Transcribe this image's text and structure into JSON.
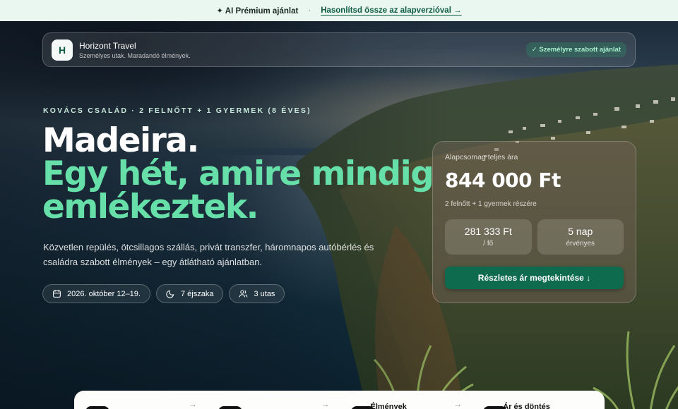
{
  "topbar": {
    "ai_label": "✦ AI Prémium ajánlat",
    "separator": "·",
    "compare_link": "Hasonlítsd össze az alapverzióval →"
  },
  "brand": {
    "logo_letter": "H",
    "name": "Horizont Travel",
    "tagline": "Személyes utak. Maradandó élmények.",
    "badge": "✓ Személyre szabott ajánlat"
  },
  "hero": {
    "eyebrow": "KOVÁCS CSALÁD · 2 FELNŐTT + 1 GYERMEK (8 ÉVES)",
    "title_line1": "Madeira.",
    "title_line2": "Egy hét, amire mindig",
    "title_line3": "emlékeztek.",
    "lead": "Közvetlen repülés, ötcsillagos szállás, privát transzfer, háromnapos autóbérlés és családra szabott élmények – egy átlátható ajánlatban.",
    "chips": [
      {
        "icon": "calendar-icon",
        "label": "2026. október 12–19."
      },
      {
        "icon": "moon-icon",
        "label": "7 éjszaka"
      },
      {
        "icon": "users-icon",
        "label": "3 utas"
      }
    ]
  },
  "price_card": {
    "label": "Alapcsomag teljes ára",
    "amount": "844 000 Ft",
    "sub": "2 felnőtt + 1 gyermek részére",
    "stats": [
      {
        "value": "281 333 Ft",
        "unit": "/ fő"
      },
      {
        "value": "5 nap",
        "unit": "érvényes"
      }
    ],
    "cta": "Részletes ár megtekintése ↓"
  },
  "steps": [
    {
      "title": "",
      "arrow": "→"
    },
    {
      "title": "",
      "arrow": "→"
    },
    {
      "title": "Élmények",
      "arrow": "→"
    },
    {
      "title": "Ár és döntés",
      "arrow": ""
    }
  ],
  "colors": {
    "accent_green": "#66e0a8",
    "cta_green": "#0f6b4e",
    "topbar_bg": "#e9f7f0"
  }
}
